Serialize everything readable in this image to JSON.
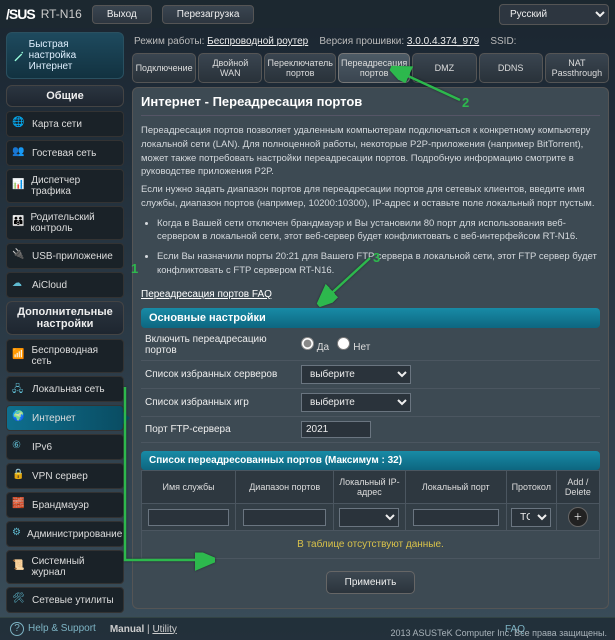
{
  "top": {
    "brand": "/SUS",
    "model": "RT-N16",
    "logout": "Выход",
    "reboot": "Перезагрузка",
    "language": "Русский"
  },
  "mode": {
    "label": "Режим работы:",
    "value": "Беспроводной роутер",
    "fwlabel": "Версия прошивки:",
    "fwval": "3.0.0.4.374_979",
    "ssidlabel": "SSID:"
  },
  "quick": "Быстрая настройка Интернет",
  "section1": "Общие",
  "general": [
    "Карта сети",
    "Гостевая сеть",
    "Диспетчер трафика",
    "Родительский контроль",
    "USB-приложение",
    "AiCloud"
  ],
  "section2": "Дополнительные настройки",
  "adv": [
    "Беспроводная сеть",
    "Локальная сеть",
    "Интернет",
    "IPv6",
    "VPN сервер",
    "Брандмауэр",
    "Администрирование",
    "Системный журнал",
    "Сетевые утилиты"
  ],
  "tabs": [
    "Подключение",
    "Двойной WAN",
    "Переключатель портов",
    "Переадресация портов",
    "DMZ",
    "DDNS",
    "NAT Passthrough"
  ],
  "page": {
    "title": "Интернет - Переадресация портов",
    "p1": "Переадресация портов позволяет удаленным компьютерам подключаться к конкретному компьютеру локальной сети (LAN). Для полноценной работы, некоторые P2P-приложения (например BitTorrent), может также потребовать настройки переадресации портов. Подробную информацию смотрите в руководстве приложения P2P.",
    "p2": "Если нужно задать диапазон портов для переадресации портов для сетевых клиентов, введите имя службы, диапазон портов (например, 10200:10300), IP-адрес и оставьте поле локальный порт пустым.",
    "li1": "Когда в Вашей сети отключен брандмауэр и Вы установили 80 порт для использования веб-сервером в локальной сети, этот веб-сервер будет конфликтовать с веб-интерфейсом RT-N16.",
    "li2": "Если Вы назначили порты 20:21 для Вашего FTP сервера в локальной сети, этот FTP сервер будет конфликтовать с FTP сервером RT-N16.",
    "faq": "Переадресация портов FAQ"
  },
  "form": {
    "header": "Основные настройки",
    "enable_lbl": "Включить переадресацию портов",
    "yes": "Да",
    "no": "Нет",
    "servers_lbl": "Список избранных серверов",
    "games_lbl": "Список избранных игр",
    "select_ph": "выберите",
    "ftp_lbl": "Порт FTP-сервера",
    "ftp_val": "2021"
  },
  "tablehdr": "Список переадресованных портов (Максимум : 32)",
  "cols": {
    "c1": "Имя службы",
    "c2": "Диапазон портов",
    "c3": "Локальный IP-адрес",
    "c4": "Локальный порт",
    "c5": "Протокол",
    "c6": "Add / Delete"
  },
  "proto": "TCP",
  "nodata": "В таблице отсутствуют данные.",
  "apply": "Применить",
  "footer": {
    "help": "Help & Support",
    "manual": "Manual",
    "utility": "Utility",
    "faq": "FAQ"
  },
  "copy": "2013 ASUSTeK Computer Inc. Все права защищены.",
  "annot": {
    "n1": "1",
    "n2": "2",
    "n3": "3"
  }
}
